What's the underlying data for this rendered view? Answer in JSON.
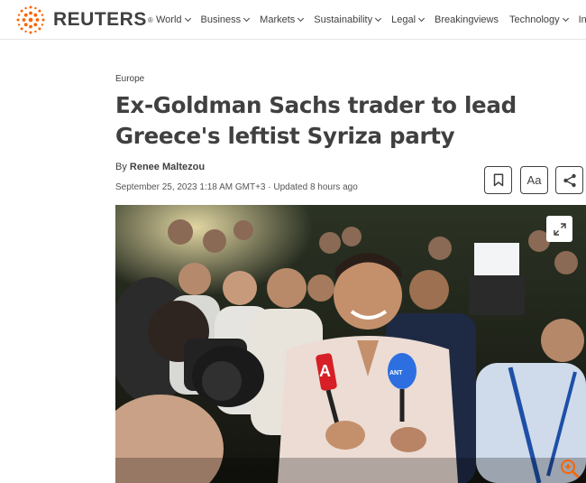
{
  "brand": {
    "logo_text": "REUTERS",
    "registered_mark": "®",
    "accent_color": "#fa6400"
  },
  "nav": {
    "items": [
      {
        "label": "World",
        "has_dropdown": true
      },
      {
        "label": "Business",
        "has_dropdown": true
      },
      {
        "label": "Markets",
        "has_dropdown": true
      },
      {
        "label": "Sustainability",
        "has_dropdown": true
      },
      {
        "label": "Legal",
        "has_dropdown": true
      },
      {
        "label": "Breakingviews",
        "has_dropdown": false
      },
      {
        "label": "Technology",
        "has_dropdown": true
      },
      {
        "label": "Inv",
        "has_dropdown": false
      }
    ]
  },
  "article": {
    "section": "Europe",
    "headline": "Ex-Goldman Sachs trader to lead Greece's leftist Syriza party",
    "byline_prefix": "By ",
    "author": "Renee Maltezou",
    "date": "September 25, 2023 1:18 AM GMT+3 · Updated 8 hours ago"
  },
  "toolbar": {
    "bookmark_icon": "bookmark-icon",
    "text_size_label": "Aa",
    "share_icon": "share-icon"
  },
  "photo": {
    "expand_icon": "expand-icon",
    "zoom_icon": "zoom-in-icon",
    "mic_logo_left": "A",
    "mic_logo_right": "ANT"
  }
}
